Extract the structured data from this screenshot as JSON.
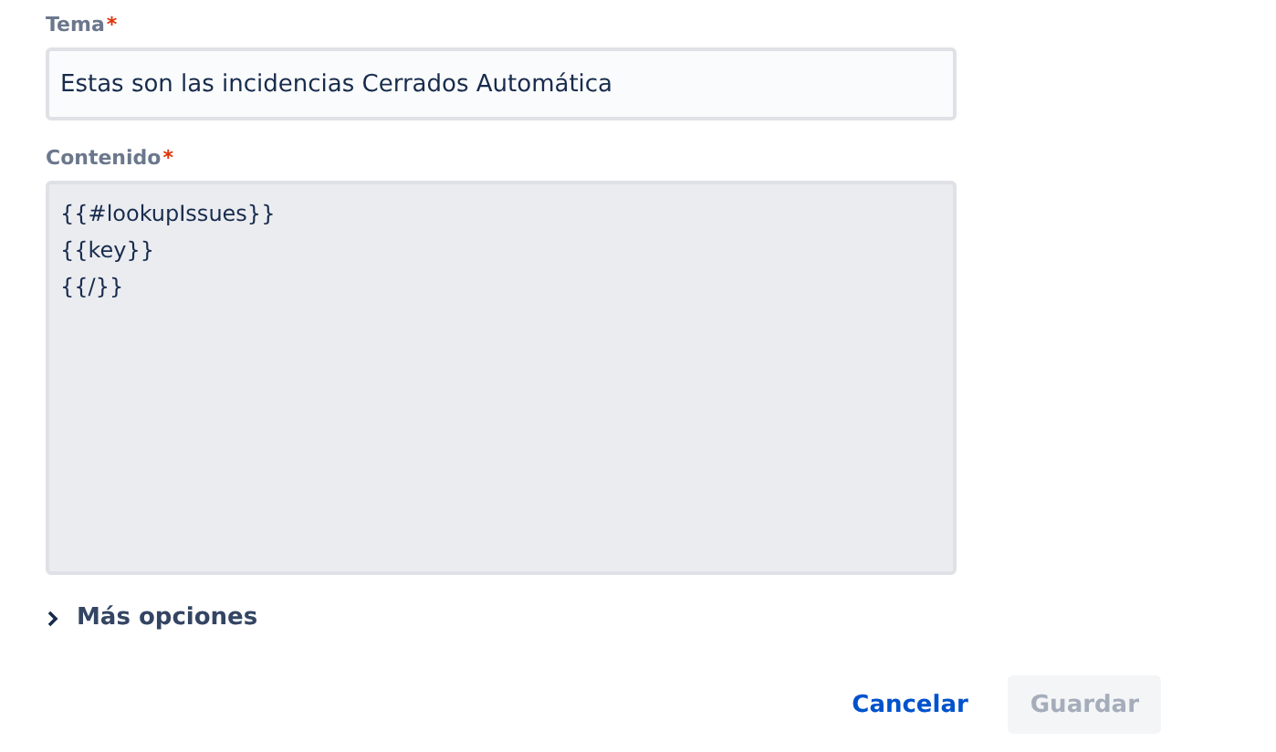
{
  "fields": [
    {
      "kind": "input",
      "label": "Tema",
      "required_mark": "*",
      "value": "Estas son las incidencias Cerrados Automática"
    },
    {
      "kind": "textarea",
      "label": "Contenido",
      "required_mark": "*",
      "value": "{{#lookupIssues}}\n{{key}}\n{{/}}"
    }
  ],
  "more_options": {
    "label": "Más opciones",
    "expanded": false
  },
  "buttons": [
    {
      "label": "Cancelar",
      "kind": "link",
      "disabled": false
    },
    {
      "label": "Guardar",
      "kind": "primary",
      "disabled": true
    }
  ]
}
